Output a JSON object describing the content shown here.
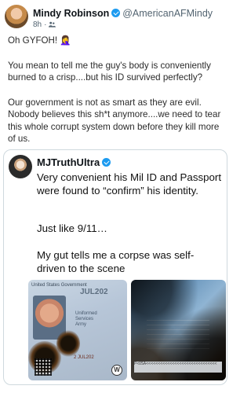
{
  "post": {
    "author_name": "Mindy Robinson",
    "author_handle": "@AmericanAFMindy",
    "time": "8h",
    "text": [
      "Oh GYFOH! 🤦‍♀️",
      "You mean to tell me the guy's body is conveniently burned to a crisp....but his ID survived perfectly?",
      "Our government is not as smart as they are evil. Nobody believes this sh*t anymore....we need to tear this whole corrupt system down before they kill more of us."
    ],
    "icons": {
      "verified": "verified-badge-icon",
      "audience": "audience-icon"
    }
  },
  "quoted_post": {
    "author_name": "MJTruthUltra",
    "text": [
      "Very convenient his Mil ID and Passport were found to “confirm” his identity.",
      "Just like 9/11…",
      "My gut tells me a corpse was self-driven to the scene"
    ],
    "media": {
      "id_card": {
        "header": "United States Government",
        "date": "JUL202",
        "lines": [
          "Uniformed",
          "Services",
          "",
          "Army"
        ],
        "bottom": "2 JUL202"
      },
      "passport": {
        "mrz": "P<USA<<<<<<<<<<<<<<<<<<<<<<<<<<<<<<"
      },
      "watermark": "W"
    }
  },
  "colors": {
    "accent": "#1d9bf0",
    "text": "#0f1419",
    "secondary": "#536471",
    "border": "#cfd9de"
  }
}
